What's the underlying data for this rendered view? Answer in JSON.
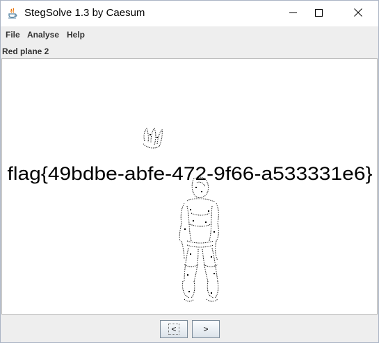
{
  "window": {
    "title": "StegSolve 1.3 by Caesum",
    "controls": {
      "minimize": "minimize-icon",
      "maximize": "maximize-icon",
      "close": "close-icon"
    }
  },
  "menubar": {
    "items": [
      "File",
      "Analyse",
      "Help"
    ]
  },
  "viewer": {
    "plane_label": "Red plane 2",
    "image_text": "flag{49bdbe-abfe-472-9f66-a533331e6}"
  },
  "navigation": {
    "prev_label": "<",
    "next_label": ">"
  },
  "colors": {
    "window_border": "#aab4c4",
    "panel_background": "#ffffff",
    "chrome_background": "#eeeeee",
    "image_ink": "#000000"
  }
}
